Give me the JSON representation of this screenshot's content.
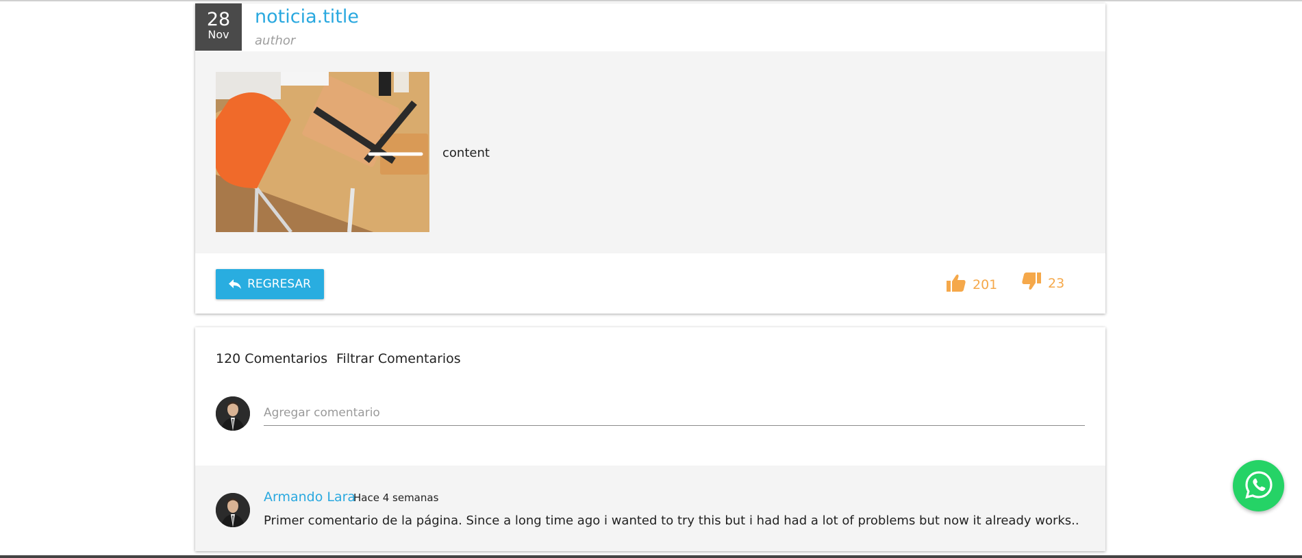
{
  "post": {
    "date_day": "28",
    "date_month": "Nov",
    "title": "noticia.title",
    "author": "author",
    "content": "content",
    "image_icon": "desk-photo",
    "back_label": "REGRESAR",
    "likes": "201",
    "dislikes": "23"
  },
  "comments": {
    "count_label": "120 Comentarios",
    "filter_label": "Filtrar Comentarios",
    "input_placeholder": "Agregar comentario",
    "items": [
      {
        "author": "Armando Lara",
        "time": "Hace 4 semanas",
        "text": "Primer comentario de la página. Since a long time ago i wanted to try this but i had had a lot of problems but now it already works.."
      }
    ]
  },
  "colors": {
    "accent": "#29a8df",
    "button": "#29ade0",
    "vote": "#f5a84a",
    "date_badge": "#4a4a4a",
    "whatsapp": "#25d366"
  },
  "icons": {
    "back": "reply-arrow-icon",
    "like": "thumbs-up-icon",
    "dislike": "thumbs-down-icon",
    "whatsapp": "whatsapp-icon"
  }
}
